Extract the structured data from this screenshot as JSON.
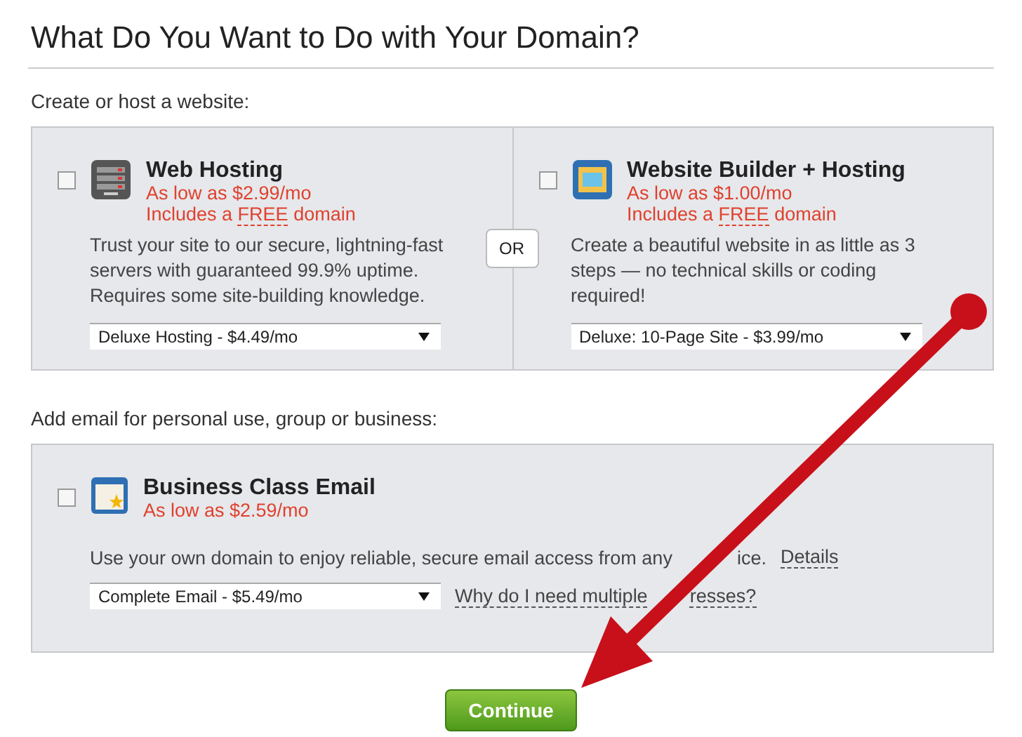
{
  "title": "What Do You Want to Do with Your Domain?",
  "website_section": {
    "label": "Create or host a website:",
    "or_label": "OR",
    "options": [
      {
        "kind": "server",
        "name": "Web Hosting",
        "price": "As low as $2.99/mo",
        "free_prefix": "Includes a ",
        "free_word": "FREE",
        "free_suffix": " domain",
        "description": "Trust your site to our secure, lightning-fast servers with guaranteed 99.9% uptime. Requires some site-building knowledge.",
        "plan": "Deluxe Hosting - $4.49/mo",
        "checked": false
      },
      {
        "kind": "builder",
        "name": "Website Builder + Hosting",
        "price": "As low as $1.00/mo",
        "free_prefix": "Includes a ",
        "free_word": "FREE",
        "free_suffix": " domain",
        "description": "Create a beautiful website in as little as 3 steps — no technical skills or coding required!",
        "plan": "Deluxe: 10-Page Site - $3.99/mo",
        "checked": false
      }
    ]
  },
  "email_section": {
    "label": "Add email for personal use, group or business:",
    "option": {
      "name": "Business Class Email",
      "price": "As low as $2.59/mo",
      "description": [
        "Use your own domain to enjoy reliable, secure email access from any",
        "ice."
      ],
      "details_link": "Details",
      "plan": "Complete Email - $5.49/mo",
      "help_link": [
        "Why do I need multiple",
        "resses?"
      ],
      "checked": false
    }
  },
  "continue_button": "Continue"
}
